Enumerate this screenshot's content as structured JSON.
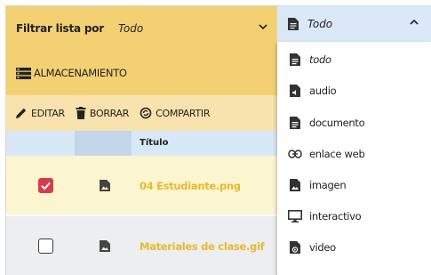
{
  "filter": {
    "label": "Filtrar lista por",
    "value": "Todo"
  },
  "storage": {
    "label": "ALMACENAMIENTO"
  },
  "toolbar": {
    "edit": "EDITAR",
    "delete": "BORRAR",
    "share": "COMPARTIR"
  },
  "table": {
    "header_title": "Título",
    "rows": [
      {
        "name": "04 Estudiante.png",
        "checked": true
      },
      {
        "name": "Materiales de clase.gif",
        "checked": false
      }
    ]
  },
  "dropdown": {
    "selected": "Todo",
    "options": [
      "todo",
      "audio",
      "documento",
      "enlace web",
      "imagen",
      "interactivo",
      "video"
    ]
  },
  "colors": {
    "accent": "#f3d173",
    "check": "#d93a4e",
    "filename": "#e8b930",
    "header": "#d9e8f6"
  }
}
